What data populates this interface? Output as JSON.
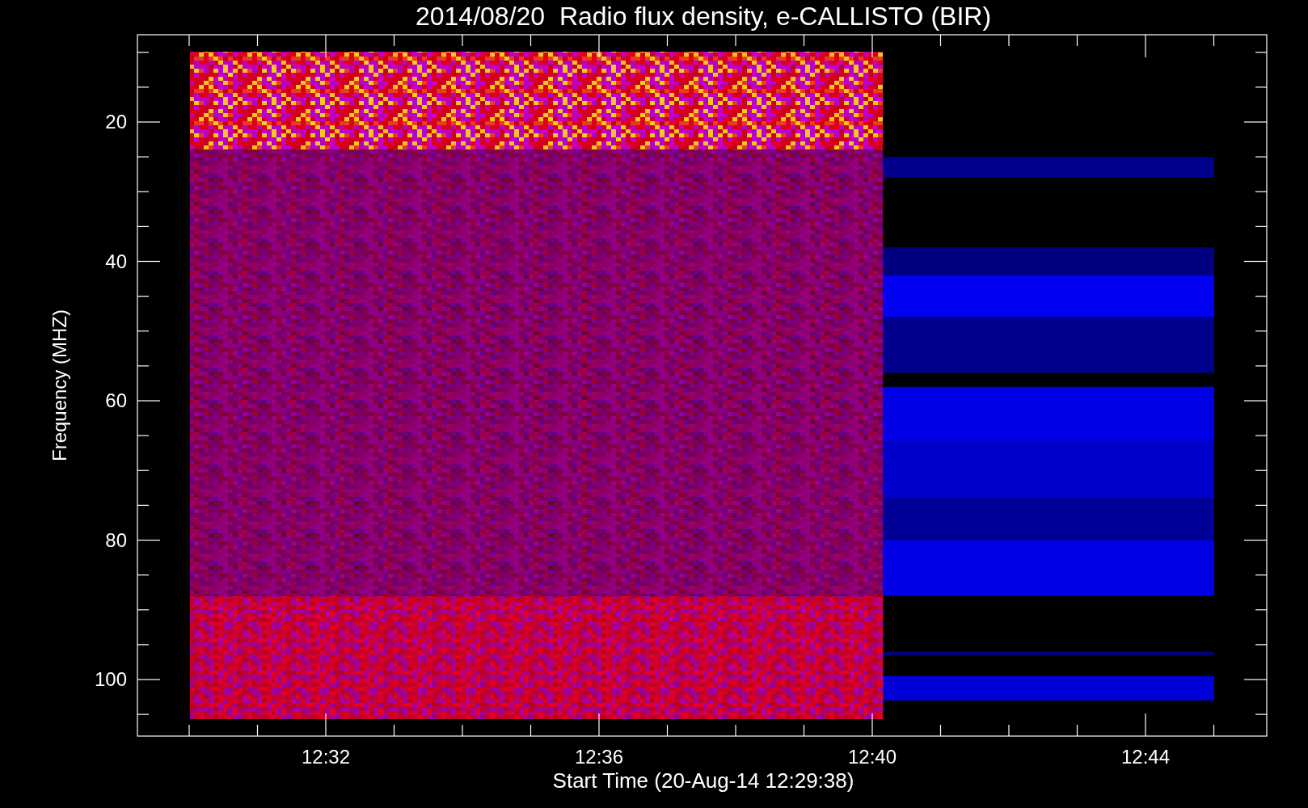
{
  "title": "2014/08/20  Radio flux density, e-CALLISTO (BIR)",
  "y_axis": {
    "label": "Frequency (MHZ)",
    "ticks": [
      "20",
      "40",
      "60",
      "80",
      "100"
    ]
  },
  "x_axis": {
    "label": "Start Time (20-Aug-14 12:29:38)",
    "ticks": [
      "12:32",
      "12:36",
      "12:40",
      "12:44"
    ]
  }
}
